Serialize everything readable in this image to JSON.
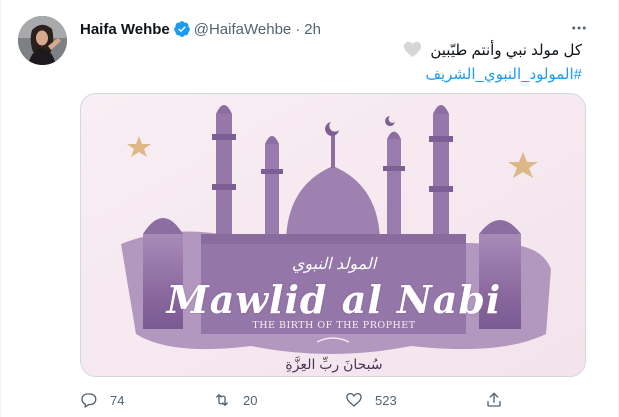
{
  "author": {
    "name": "Haifa Wehbe",
    "handle": "@HaifaWehbe",
    "separator": "·",
    "time": "2h",
    "verified": true
  },
  "tweet": {
    "text": "كل مولد نبي وأنتم طيّبين",
    "hashtag": "#المولود_النبوي_الشريف",
    "emoji": "heart-icon"
  },
  "media": {
    "arabic_script": "المولد النبوي",
    "title": "Mawlid al Nabi",
    "subtitle": "THE BIRTH OF THE PROPHET",
    "arabic_bottom": "سُبحانَ ربِّ العِزَّةِ"
  },
  "actions": {
    "reply_count": "74",
    "retweet_count": "20",
    "like_count": "523"
  },
  "colors": {
    "accent": "#1d9bf0",
    "muted": "#536471",
    "verified": "#1d9bf0",
    "heart": "#cfcfcf",
    "mosque": "#8b6a9e",
    "star": "#d9b27a"
  }
}
